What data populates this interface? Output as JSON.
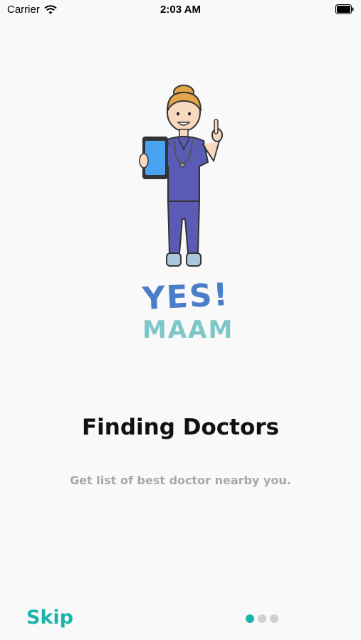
{
  "status_bar": {
    "carrier": "Carrier",
    "time": "2:03 AM"
  },
  "illustration": {
    "icon": "nurse-holding-phone-illustration"
  },
  "logo": {
    "line1": "YES!",
    "line2": "MAAM",
    "colors": {
      "line1": "#4a7ec8",
      "line2": "#7ec6c8"
    }
  },
  "onboarding": {
    "title": "Finding Doctors",
    "description": "Get list of best doctor nearby you."
  },
  "footer": {
    "skip_label": "Skip",
    "pages_total": 3,
    "current_page": 1
  },
  "colors": {
    "accent": "#1bb4ad",
    "background": "#f9f9f9",
    "dot_inactive": "#d0d0d0"
  }
}
